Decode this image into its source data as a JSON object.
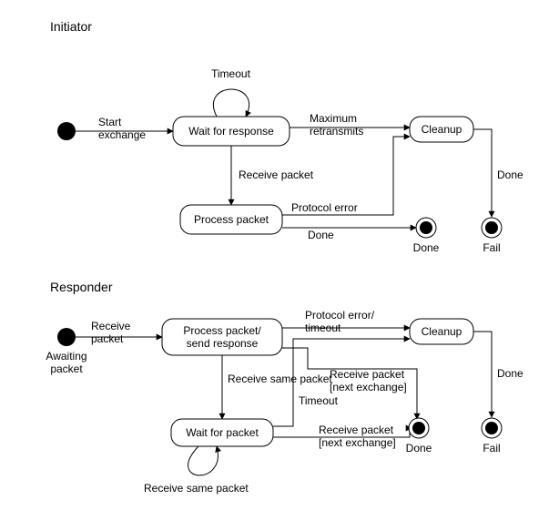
{
  "diagram": {
    "initiator": {
      "title": "Initiator",
      "states": {
        "wait": "Wait for response",
        "process": "Process packet",
        "cleanup": "Cleanup"
      },
      "edges": {
        "start": "Start\nexchange",
        "timeout": "Timeout",
        "max_retx": "Maximum\nretransmits",
        "recv": "Receive packet",
        "proto_err": "Protocol error",
        "done_edge": "Done",
        "cleanup_done": "Done"
      },
      "finals": {
        "done": "Done",
        "fail": "Fail"
      }
    },
    "responder": {
      "title": "Responder",
      "start_label": "Awaiting\npacket",
      "states": {
        "process": "Process packet/\nsend response",
        "wait": "Wait for packet",
        "cleanup": "Cleanup"
      },
      "edges": {
        "recv": "Receive\npacket",
        "proto_err": "Protocol error/\ntimeout",
        "recv_same1": "Receive same packet",
        "recv_same2": "Receive same packet",
        "timeout": "Timeout",
        "recv_next1": "Receive packet\n[next exchange]",
        "recv_next2": "Receive packet\n[next exchange]",
        "cleanup_done": "Done"
      },
      "finals": {
        "done": "Done",
        "fail": "Fail"
      }
    }
  }
}
